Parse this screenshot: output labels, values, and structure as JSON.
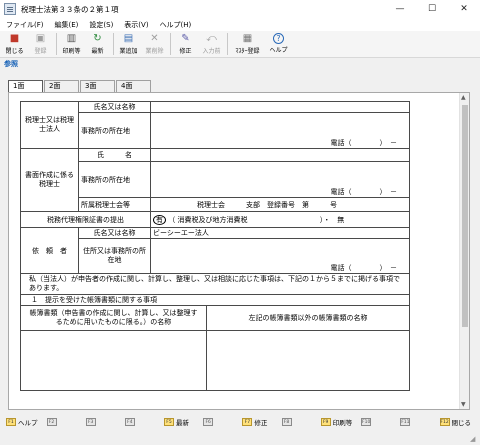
{
  "window": {
    "title": "税理士法第３３条の２第１項",
    "minimize": "—",
    "maximize": "☐",
    "close": "✕"
  },
  "menu": [
    "ファイル(F)",
    "編集(E)",
    "設定(S)",
    "表示(V)",
    "ヘルプ(H)"
  ],
  "toolbar": [
    {
      "label": "閉じる",
      "icon": "close-door-icon",
      "glyph": "🚪",
      "enabled": true
    },
    {
      "label": "登録",
      "icon": "save-icon",
      "glyph": "💾",
      "enabled": false
    },
    {
      "label": "印刷等",
      "icon": "printer-icon",
      "glyph": "🖨",
      "enabled": true
    },
    {
      "label": "最新",
      "icon": "refresh-icon",
      "glyph": "↻",
      "enabled": true
    },
    {
      "label": "業追加",
      "icon": "add-row-icon",
      "glyph": "▤",
      "enabled": true
    },
    {
      "label": "業削除",
      "icon": "delete-row-icon",
      "glyph": "✕",
      "enabled": false
    },
    {
      "label": "修正",
      "icon": "edit-icon",
      "glyph": "✎",
      "enabled": true
    },
    {
      "label": "入力前",
      "icon": "undo-icon",
      "glyph": "⤺",
      "enabled": false
    },
    {
      "label": "ﾏｽﾀｰ登録",
      "icon": "master-register-icon",
      "glyph": "▦",
      "enabled": true
    },
    {
      "label": "ヘルプ",
      "icon": "help-icon",
      "glyph": "?",
      "enabled": true
    }
  ],
  "reference_label": "参照",
  "tabs": [
    "1面",
    "2面",
    "3面",
    "4面"
  ],
  "form": {
    "tax_accountant_header": "税理士又は税理士法人",
    "name_label": "氏名又は名称",
    "office_label": "事務所の所在地",
    "tel_text": "電話（　　　　）　－",
    "preparer_header": "書面作成に係る税理士",
    "shimei_label": "氏　　　名",
    "office_label2": "事務所の所在地",
    "association_label": "所属税理士会等",
    "association_value": "税理士会　　　支部　登録番号　第　　　号",
    "power_label": "税務代理権限証書の提出",
    "power_circled": "有",
    "power_detail": "（ 消費税及び地方消費税",
    "power_none": "）・　無",
    "client_header": "依　頼　者",
    "client_name_label": "氏名又は名称",
    "client_name_value": "ビーシーエー法人",
    "client_address_label": "住所又は事務所の所在地",
    "note": "私（当法人）が申告者の作成に関し、計算し、整理し、又は相談に応じた事項は、下記の１から５までに掲げる事項であります。",
    "section1": "１　提示を受けた帳簿書類に関する事項",
    "col_ledger": "帳簿書類（申告書の作成に関し、計算し、又は整理するために用いたものに限る。）の名称",
    "col_other": "左記の帳簿書類以外の帳簿書類の名称"
  },
  "fkeys": [
    {
      "key": "F1",
      "label": "ヘルプ",
      "on": true
    },
    {
      "key": "F2",
      "label": "",
      "on": false
    },
    {
      "key": "F3",
      "label": "",
      "on": false
    },
    {
      "key": "F4",
      "label": "",
      "on": false
    },
    {
      "key": "F5",
      "label": "最新",
      "on": true
    },
    {
      "key": "F6",
      "label": "",
      "on": false
    },
    {
      "key": "F7",
      "label": "修正",
      "on": true
    },
    {
      "key": "F8",
      "label": "",
      "on": false
    },
    {
      "key": "F9",
      "label": "印刷等",
      "on": true
    },
    {
      "key": "F10",
      "label": "",
      "on": false
    },
    {
      "key": "F11",
      "label": "",
      "on": false
    },
    {
      "key": "F12",
      "label": "閉じる",
      "on": true
    }
  ]
}
